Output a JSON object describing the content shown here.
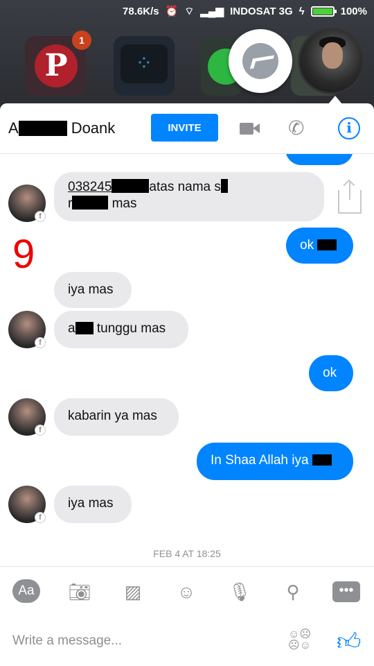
{
  "status_bar": {
    "speed": "78.6K/s",
    "carrier": "INDOSAT 3G",
    "battery": "100%"
  },
  "home": {
    "pinterest_badge": "1"
  },
  "header": {
    "title_start": "A",
    "title_end": "Doank",
    "invite_label": "INVITE"
  },
  "annotation": "9",
  "messages": [
    {
      "side": "in",
      "text_a": "038245",
      "text_b": "atas nama s",
      "text_c": "r",
      "text_d": "mas"
    },
    {
      "side": "out",
      "text": "ok"
    },
    {
      "side": "in",
      "text": "iya mas"
    },
    {
      "side": "in",
      "text_a": "a",
      "text_b": "tunggu mas"
    },
    {
      "side": "out",
      "text": "ok"
    },
    {
      "side": "in",
      "text": "kabarin ya mas"
    },
    {
      "side": "out",
      "text": "In Shaa Allah iya"
    },
    {
      "side": "in",
      "text": "iya mas"
    }
  ],
  "timestamp": "FEB 4 AT 18:25",
  "toolbar": {
    "aa_label": "Aa"
  },
  "composer": {
    "placeholder": "Write a message..."
  }
}
